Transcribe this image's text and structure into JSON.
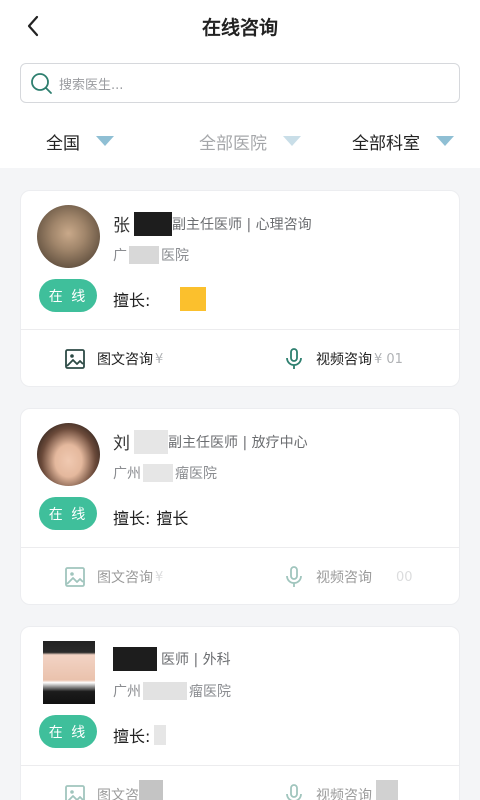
{
  "header": {
    "title": "在线咨询"
  },
  "search": {
    "placeholder": "搜索医生..."
  },
  "filters": [
    {
      "label": "全国"
    },
    {
      "label": "全部医院"
    },
    {
      "label": "全部科室"
    }
  ],
  "doctors": [
    {
      "name": "张",
      "title_dept": "副主任医师 | 心理咨询",
      "hospital_prefix": "广",
      "hospital_suffix": "医院",
      "status": "在 线",
      "skill_label": "擅长:",
      "skill_value": "",
      "actions": [
        {
          "label": "图文咨询",
          "price": "¥"
        },
        {
          "label": "视频咨询",
          "price": "¥ 01"
        }
      ]
    },
    {
      "name": "刘",
      "title_dept": "副主任医师 | 放疗中心",
      "hospital_prefix": "广州",
      "hospital_suffix": "瘤医院",
      "status": "在 线",
      "skill_label": "擅长:",
      "skill_value": "擅长",
      "actions": [
        {
          "label": "图文咨询",
          "price": "¥"
        },
        {
          "label": "视频咨询",
          "price": "00"
        }
      ]
    },
    {
      "name": "",
      "title_dept": "医师 | 外科",
      "hospital_prefix": "广州",
      "hospital_suffix": "瘤医院",
      "status": "在 线",
      "skill_label": "擅长:",
      "skill_value": "",
      "actions": [
        {
          "label": "图文咨",
          "price": ""
        },
        {
          "label": "视频咨询",
          "price": ""
        }
      ]
    }
  ]
}
